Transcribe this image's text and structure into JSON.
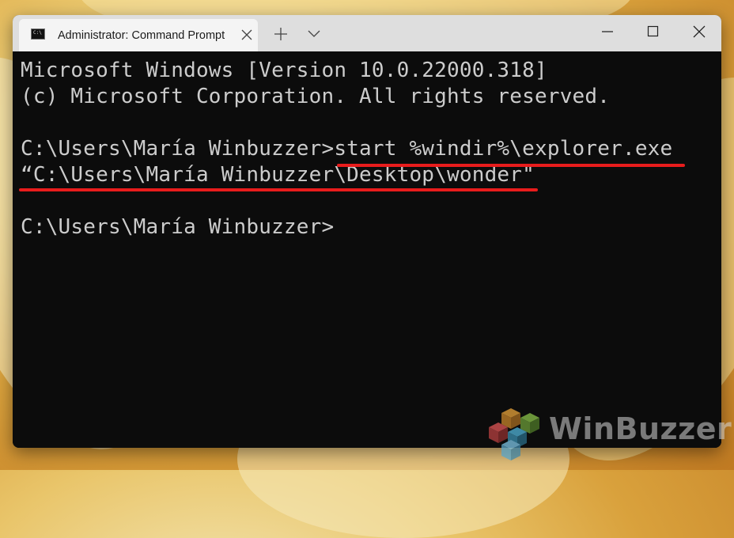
{
  "tab": {
    "title": "Administrator: Command Prompt",
    "icon": "command-prompt-icon"
  },
  "titlebar": {
    "close_tab_icon": "close-icon",
    "new_tab_icon": "plus-icon",
    "dropdown_icon": "chevron-down-icon",
    "minimize_icon": "minimize-icon",
    "maximize_icon": "maximize-icon",
    "close_window_icon": "close-icon"
  },
  "console": {
    "lines": [
      "Microsoft Windows [Version 10.0.22000.318]",
      "(c) Microsoft Corporation. All rights reserved.",
      "C:\\Users\\María Winbuzzer>start %windir%\\explorer.exe",
      "“C:\\Users\\María Winbuzzer\\Desktop\\wonder\"",
      "C:\\Users\\María Winbuzzer>"
    ]
  },
  "watermark": {
    "text": "WinBuzzer"
  },
  "colors": {
    "console_bg": "#0c0c0c",
    "console_text": "#cccccc",
    "underline": "#e81c1c",
    "titlebar": "#dedede"
  }
}
